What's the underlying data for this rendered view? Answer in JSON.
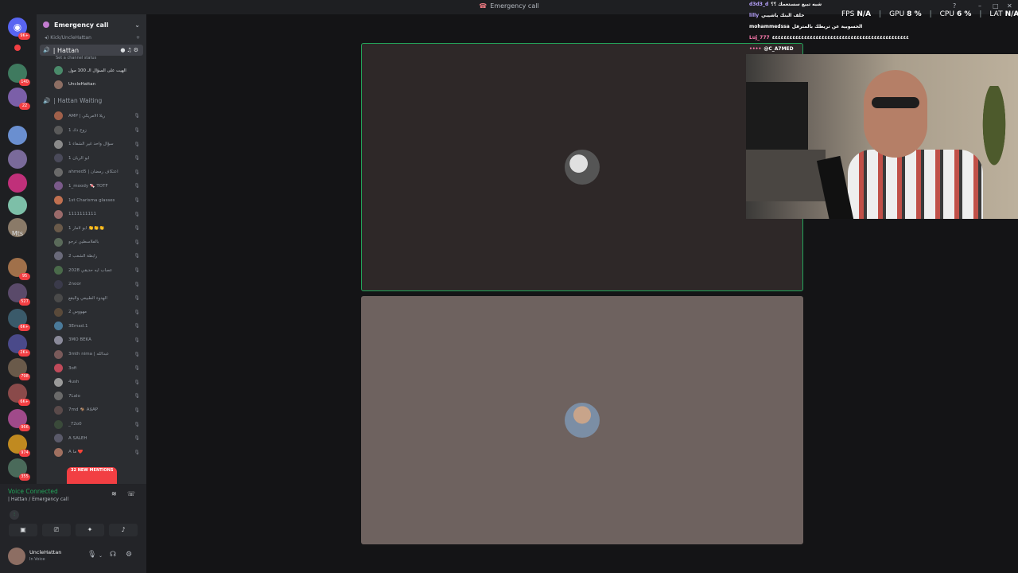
{
  "window": {
    "title": "Emergency call",
    "title_icon": "phone-icon"
  },
  "guild_list": {
    "text_guild": "Mts",
    "badges": [
      "9K+",
      "140",
      "22",
      "95",
      "527",
      "6K+",
      "2K+",
      "798",
      "6K+",
      "966",
      "974",
      "355"
    ]
  },
  "channel_panel": {
    "header": "Emergency call",
    "subheader": "Kick/UncleHattan",
    "active_channel": "| Hattan",
    "set_status": "Set a channel status",
    "active_members": [
      "الهيت على السؤال الـ 100 مول",
      "UncleHattan"
    ],
    "waiting_channel": "| Hattan Waiting",
    "waiting_members": [
      "AMP | ريلا الأمريكي",
      "زوج دك 1",
      "1 سؤال واحد غير الشفاء",
      "1 ابو الريان",
      "ahmed5 | اعتكاف رمضان",
      "1_moody 🍬 TOTF",
      "1st Charisma glasses",
      "1111111111",
      "1 ابو لامار 👏👏👏",
      "بالفلاسطين ترجو",
      "2 رابطة الشعب",
      "2028 عصاب ايه حديقي",
      "2noor",
      "الهدوء الطبيعي والبقع",
      "2 مهووس",
      "3Emad.1",
      "3MO BEKA",
      "3mth nima | عبدالله",
      "3ofi",
      "4ush",
      "7Lalo",
      "7md 🐐 A$AP",
      "_72o0",
      "A SALEH",
      "A ما ❤️"
    ],
    "new_mentions": "32 NEW MENTIONS"
  },
  "voice_panel": {
    "status": "Voice Connected",
    "channel_path": "| Hattan / Emergency call"
  },
  "user_panel": {
    "username": "UncleHattan",
    "status": "In Voice"
  },
  "stream_overlay": {
    "chat": [
      {
        "user": "d3d3_d",
        "message": "شبه تبيع سستعمك ؟؟"
      },
      {
        "user": "lilly",
        "message": "خلف البنك ياشيبي"
      },
      {
        "user": "mohammedssa",
        "message": "الحسوبية عن تريطك بالمترفل"
      },
      {
        "user": "Luj_777",
        "message": "٤٤٤٤٤٤٤٤٤٤٤٤٤٤٤٤٤٤٤٤٤٤٤٤٤٤٤٤٤٤٤٤٤٤٤٤٤٤٤٤٤٤٤٤٤٤٤"
      },
      {
        "user": "••••",
        "message": "@C_A7MED"
      }
    ],
    "perf": {
      "fps_label": "FPS",
      "fps_value": "N/A",
      "gpu_label": "GPU",
      "gpu_value": "8 %",
      "cpu_label": "CPU",
      "cpu_value": "6 %",
      "lat_label": "LAT",
      "lat_value": "N/A"
    }
  },
  "colors": {
    "speaking_outline": "#23a55a",
    "mention_badge": "#f23f43",
    "voice_connected": "#23a55a"
  }
}
